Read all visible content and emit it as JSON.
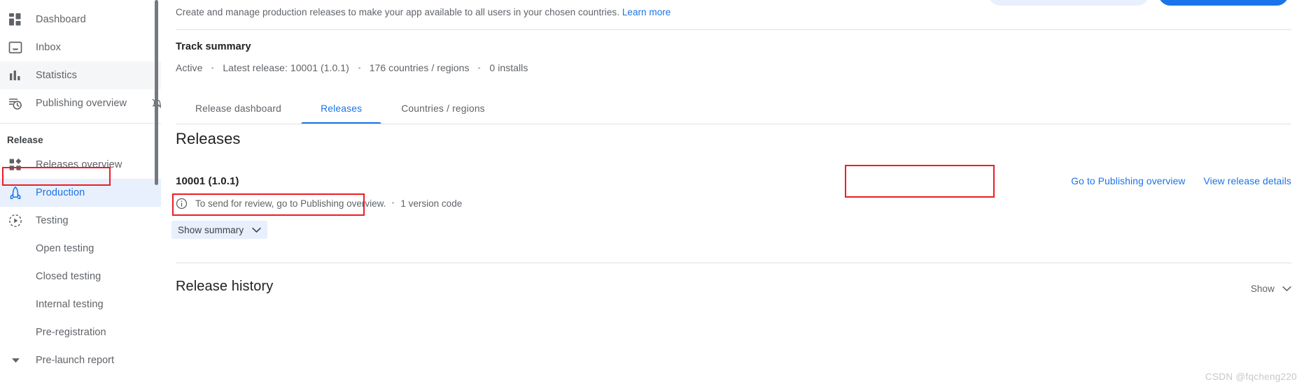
{
  "sidebar": {
    "items": [
      {
        "label": "Dashboard",
        "icon": "dashboard-icon",
        "state": "default"
      },
      {
        "label": "Inbox",
        "icon": "inbox-icon",
        "state": "default"
      },
      {
        "label": "Statistics",
        "icon": "statistics-icon",
        "state": "hovered"
      },
      {
        "label": "Publishing overview",
        "icon": "publishing-overview-icon",
        "trailing_icon": "bell-off-icon",
        "state": "default"
      }
    ],
    "group_title": "Release",
    "release_items": [
      {
        "label": "Releases overview",
        "icon": "releases-overview-icon",
        "state": "default"
      },
      {
        "label": "Production",
        "icon": "production-icon",
        "state": "selected"
      },
      {
        "label": "Testing",
        "icon": "testing-icon",
        "state": "default"
      },
      {
        "label": "Open testing",
        "icon": "",
        "state": "sub"
      },
      {
        "label": "Closed testing",
        "icon": "",
        "state": "sub"
      },
      {
        "label": "Internal testing",
        "icon": "",
        "state": "sub"
      },
      {
        "label": "Pre-registration",
        "icon": "",
        "state": "sub"
      },
      {
        "label": "Pre-launch report",
        "icon": "caret-down-icon",
        "state": "caret"
      }
    ]
  },
  "main": {
    "intro": {
      "text": "Create and manage production releases to make your app available to all users in your chosen countries.",
      "link_label": "Learn more"
    },
    "track_summary": {
      "heading": "Track summary",
      "status": "Active",
      "latest_release": "Latest release: 10001 (1.0.1)",
      "countries": "176 countries / regions",
      "installs": "0 installs"
    },
    "tabs": [
      {
        "label": "Release dashboard",
        "active": false
      },
      {
        "label": "Releases",
        "active": true
      },
      {
        "label": "Countries / regions",
        "active": false
      }
    ],
    "page_title": "Releases",
    "release": {
      "version": "10001 (1.0.1)",
      "status_message": "To send for review, go to Publishing overview.",
      "version_code": "1 version code",
      "show_summary_label": "Show summary",
      "actions": [
        {
          "label": "Go to Publishing overview",
          "highlighted": true
        },
        {
          "label": "View release details",
          "highlighted": false
        }
      ]
    },
    "release_history": {
      "title": "Release history",
      "show_label": "Show"
    }
  },
  "watermark": "CSDN @fqcheng220",
  "colors": {
    "accent": "#1a73e8",
    "accent_bg": "#e8f0fe",
    "text_primary": "#202124",
    "text_secondary": "#5f6368",
    "annotation_red": "#ee1c25",
    "scrollbar": "#75797f"
  }
}
